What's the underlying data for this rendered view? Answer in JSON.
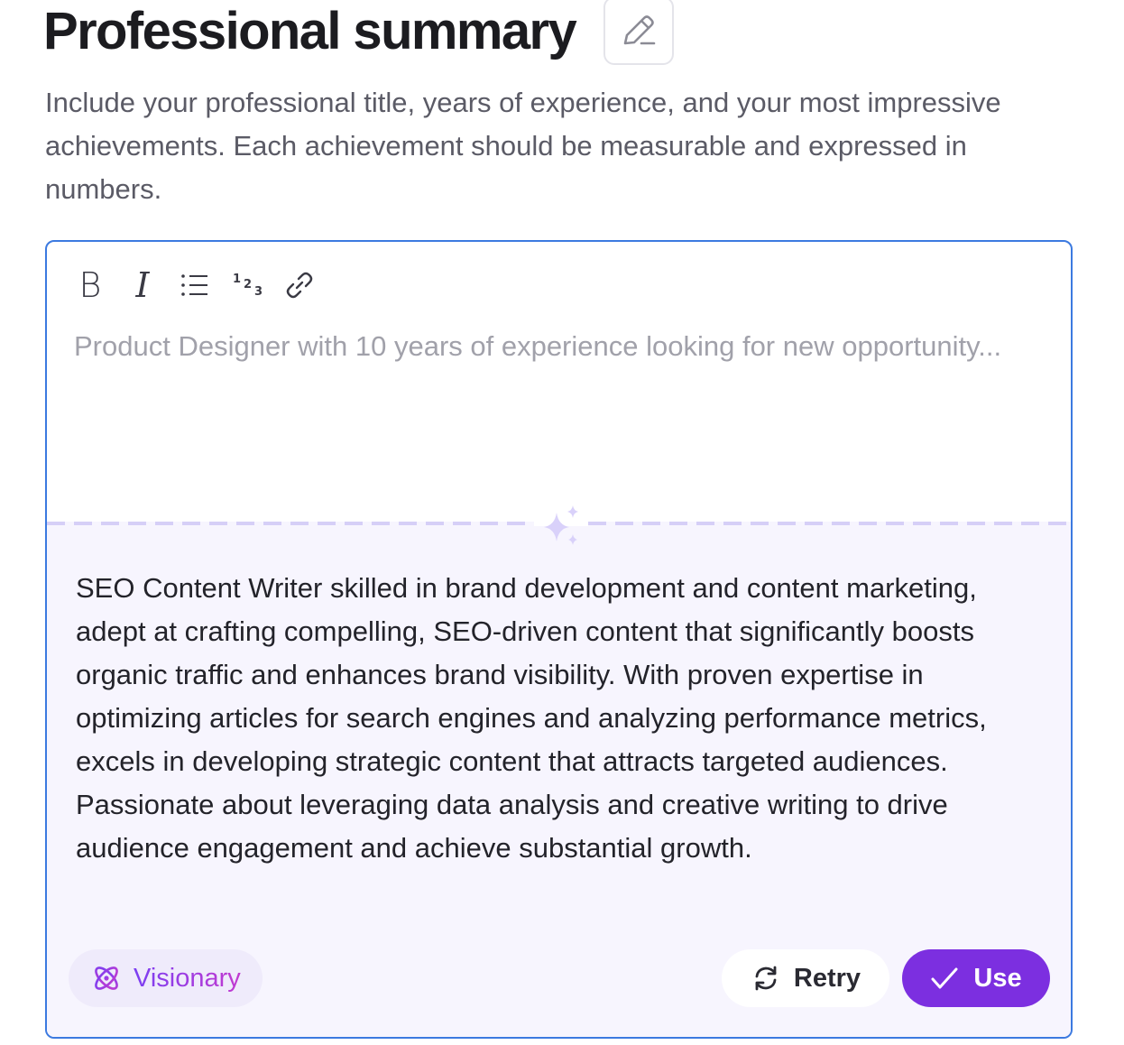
{
  "section": {
    "title": "Professional summary",
    "description": "Include your professional title, years of experience, and your most impressive achievements. Each achievement should be measurable and expressed in numbers."
  },
  "editor": {
    "toolbar": {
      "bold_glyph": "B",
      "italic_glyph": "I",
      "icons": [
        "bold-icon",
        "italic-icon",
        "bulleted-list-icon",
        "numbered-list-icon",
        "link-icon"
      ]
    },
    "placeholder": "Product Designer with 10 years of experience looking for new opportunity...",
    "value": ""
  },
  "suggestion": {
    "text": "SEO Content Writer skilled in brand development and content marketing, adept at crafting compelling, SEO-driven content that significantly boosts organic traffic and enhances brand visibility. With proven expertise in optimizing articles for search engines and analyzing performance metrics, excels in developing strategic content that attracts targeted audiences. Passionate about leveraging data analysis and creative writing to drive audience engagement and achieve substantial growth.",
    "tone_label": "Visionary",
    "retry_label": "Retry",
    "use_label": "Use"
  },
  "colors": {
    "accent_purple": "#7c2fe0",
    "focus_border": "#3c7ae0",
    "suggestion_bg": "#f7f5fe"
  }
}
